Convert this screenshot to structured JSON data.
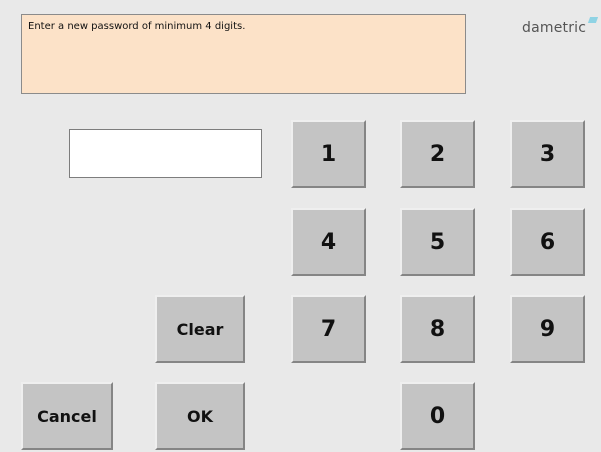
{
  "message": "Enter a new password of minimum 4 digits.",
  "brand": {
    "name": "dametric"
  },
  "password": {
    "value": ""
  },
  "keypad": {
    "k1": "1",
    "k2": "2",
    "k3": "3",
    "k4": "4",
    "k5": "5",
    "k6": "6",
    "k7": "7",
    "k8": "8",
    "k9": "9",
    "k0": "0"
  },
  "actions": {
    "clear": "Clear",
    "ok": "OK",
    "cancel": "Cancel"
  },
  "colors": {
    "message_bg": "#fce2c8",
    "background": "#e9e9e9",
    "button": "#c4c4c4"
  }
}
